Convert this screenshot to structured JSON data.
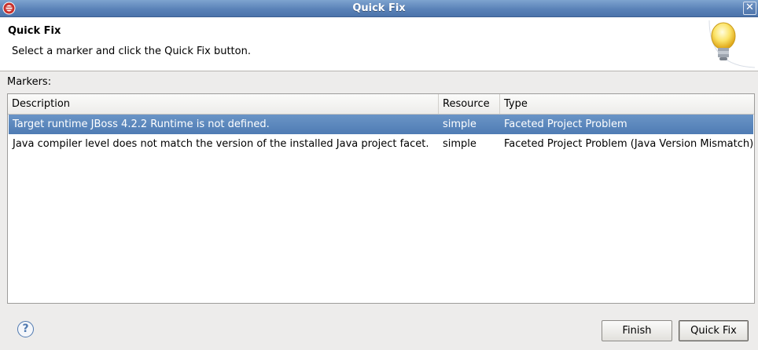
{
  "window": {
    "title": "Quick Fix",
    "close_glyph": "✕"
  },
  "header": {
    "title": "Quick Fix",
    "message": "Select a marker and click the Quick Fix button."
  },
  "markers": {
    "label": "Markers:",
    "columns": [
      "Description",
      "Resource",
      "Type"
    ],
    "rows": [
      {
        "description": "Target runtime JBoss 4.2.2 Runtime is not defined.",
        "resource": "simple",
        "type": "Faceted Project Problem",
        "selected": true
      },
      {
        "description": "Java compiler level does not match the version of the installed Java project facet.",
        "resource": "simple",
        "type": "Faceted Project Problem (Java Version Mismatch)",
        "selected": false
      }
    ]
  },
  "footer": {
    "help_glyph": "?",
    "finish_label": "Finish",
    "quickfix_label": "Quick Fix"
  },
  "colors": {
    "selection": "#5582bc",
    "titlebar": "#5a82b8"
  },
  "icons": {
    "app": "eclipse-app-icon",
    "close": "close-icon",
    "header": "lightbulb-icon",
    "help": "help-icon"
  }
}
